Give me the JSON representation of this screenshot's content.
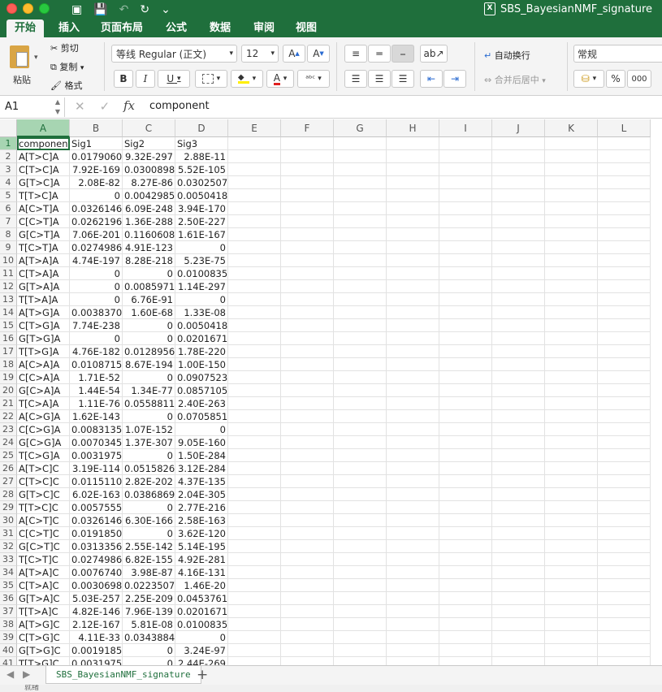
{
  "window": {
    "title": "SBS_BayesianNMF_signature"
  },
  "tabs": [
    "开始",
    "插入",
    "页面布局",
    "公式",
    "数据",
    "审阅",
    "视图"
  ],
  "ribbon": {
    "paste": "粘贴",
    "cut": "剪切",
    "copy": "复制",
    "format_painter": "格式",
    "font_name": "等线 Regular (正文)",
    "font_size": "12",
    "bold": "B",
    "italic": "I",
    "underline": "U",
    "wrap_text": "自动换行",
    "merge_center": "合并后居中",
    "number_format": "常规",
    "percent": "%",
    "comma": "000"
  },
  "formula_bar": {
    "name_box": "A1",
    "fx": "fx",
    "value": "component"
  },
  "columns": [
    "A",
    "B",
    "C",
    "D",
    "E",
    "F",
    "G",
    "H",
    "I",
    "J",
    "K",
    "L"
  ],
  "rows": [
    [
      "component",
      "Sig1",
      "Sig2",
      "Sig3"
    ],
    [
      "A[T>C]A",
      "0.01790607",
      "9.32E-297",
      "2.88E-11"
    ],
    [
      "C[T>C]A",
      "7.92E-169",
      "0.03008986",
      "5.52E-105"
    ],
    [
      "G[T>C]A",
      "2.08E-82",
      "8.27E-86",
      "0.03025077"
    ],
    [
      "T[T>C]A",
      "0",
      "0.00429855",
      "0.0050418"
    ],
    [
      "A[C>T]A",
      "0.03261463",
      "6.09E-248",
      "3.94E-170"
    ],
    [
      "C[C>T]A",
      "0.02621961",
      "1.36E-288",
      "2.50E-227"
    ],
    [
      "G[C>T]A",
      "7.06E-201",
      "0.11606088",
      "1.61E-167"
    ],
    [
      "T[C>T]A",
      "0.02749861",
      "4.91E-123",
      "0"
    ],
    [
      "A[T>A]A",
      "4.74E-197",
      "8.28E-218",
      "5.23E-75"
    ],
    [
      "C[T>A]A",
      "0",
      "0",
      "0.01008359"
    ],
    [
      "G[T>A]A",
      "0",
      "0.0085971",
      "1.14E-297"
    ],
    [
      "T[T>A]A",
      "0",
      "6.76E-91",
      "0"
    ],
    [
      "A[T>G]A",
      "0.00383701",
      "1.60E-68",
      "1.33E-08"
    ],
    [
      "C[T>G]A",
      "7.74E-238",
      "0",
      "0.0050418"
    ],
    [
      "G[T>G]A",
      "0",
      "0",
      "0.02016718"
    ],
    [
      "T[T>G]A",
      "4.76E-182",
      "0.01289565",
      "1.78E-220"
    ],
    [
      "A[C>A]A",
      "0.01087154",
      "8.67E-194",
      "1.00E-150"
    ],
    [
      "C[C>A]A",
      "1.71E-52",
      "0",
      "0.09075232"
    ],
    [
      "G[C>A]A",
      "1.44E-54",
      "1.34E-77",
      "0.08571052"
    ],
    [
      "T[C>A]A",
      "1.11E-76",
      "0.05588117",
      "2.40E-263"
    ],
    [
      "A[C>G]A",
      "1.62E-143",
      "0",
      "0.07058514"
    ],
    [
      "C[C>G]A",
      "0.00831353",
      "1.07E-152",
      "0"
    ],
    [
      "G[C>G]A",
      "0.00703453",
      "1.37E-307",
      "9.05E-160"
    ],
    [
      "T[C>G]A",
      "0.00319751",
      "0",
      "1.50E-284"
    ],
    [
      "A[T>C]C",
      "3.19E-114",
      "0.05158261",
      "3.12E-284"
    ],
    [
      "C[T>C]C",
      "0.01151105",
      "2.82E-202",
      "4.37E-135"
    ],
    [
      "G[T>C]C",
      "6.02E-163",
      "0.03868696",
      "2.04E-305"
    ],
    [
      "T[T>C]C",
      "0.00575552",
      "0",
      "2.77E-216"
    ],
    [
      "A[C>T]C",
      "0.03261463",
      "6.30E-166",
      "2.58E-163"
    ],
    [
      "C[C>T]C",
      "0.01918508",
      "0",
      "3.62E-120"
    ],
    [
      "G[C>T]C",
      "0.03133563",
      "2.55E-142",
      "5.14E-195"
    ],
    [
      "T[C>T]C",
      "0.02749861",
      "6.82E-155",
      "4.92E-281"
    ],
    [
      "A[T>A]C",
      "0.00767403",
      "3.98E-87",
      "4.16E-131"
    ],
    [
      "C[T>A]C",
      "0.00306987",
      "0.02235071",
      "1.46E-20"
    ],
    [
      "G[T>A]C",
      "5.03E-257",
      "2.25E-209",
      "0.04537616"
    ],
    [
      "T[T>A]C",
      "4.82E-146",
      "7.96E-139",
      "0.02016718"
    ],
    [
      "A[T>G]C",
      "2.12E-167",
      "5.81E-08",
      "0.01008352"
    ],
    [
      "C[T>G]C",
      "4.11E-33",
      "0.03438841",
      "0"
    ],
    [
      "G[T>G]C",
      "0.00191851",
      "0",
      "3.24E-97"
    ],
    [
      "T[T>G]C",
      "0.00319751",
      "0",
      "2.44E-269"
    ]
  ],
  "sheet_tab": "SBS_BayesianNMF_signature",
  "add_sheet": "+",
  "status": "就绪"
}
